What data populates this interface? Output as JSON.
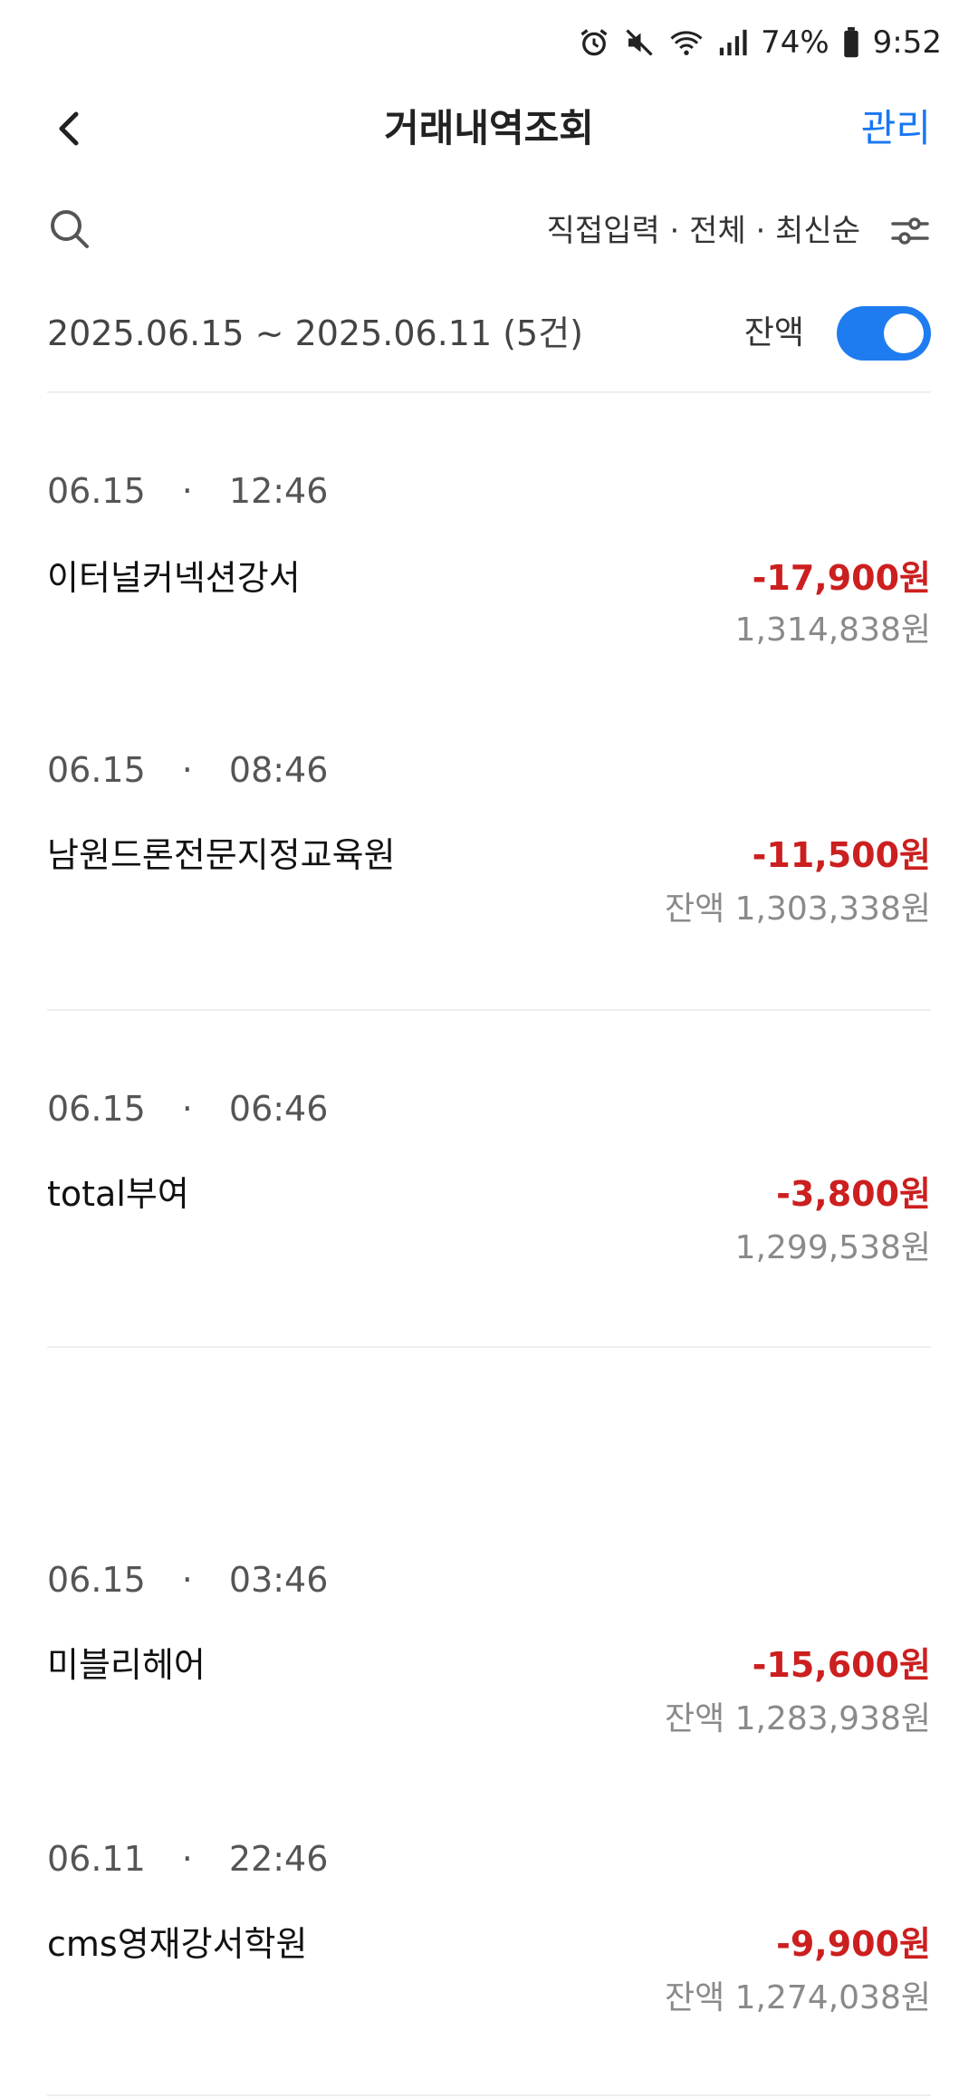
{
  "status_bar": {
    "battery": "74%",
    "time": "9:52",
    "icons": [
      "alarm-icon",
      "mute-icon",
      "wifi-icon",
      "signal-icon",
      "battery-icon"
    ]
  },
  "header": {
    "title": "거래내역조회",
    "manage_label": "관리"
  },
  "filter": {
    "summary": "직접입력 · 전체 · 최신순"
  },
  "range": {
    "text": "2025.06.15 ~ 2025.06.11 (5건)",
    "balance_label": "잔액",
    "balance_toggle_on": true
  },
  "transactions": [
    {
      "date": "06.15",
      "time": "12:46",
      "merchant": "이터널커넥션강서",
      "amount": "-17,900원",
      "balance": "1,314,838원"
    },
    {
      "date": "06.15",
      "time": "08:46",
      "merchant": "남원드론전문지정교육원",
      "amount": "-11,500원",
      "balance": "잔액 1,303,338원"
    },
    {
      "date": "06.15",
      "time": "06:46",
      "merchant": "total부여",
      "amount": "-3,800원",
      "balance": "1,299,538원"
    },
    {
      "date": "06.15",
      "time": "03:46",
      "merchant": "미블리헤어",
      "amount": "-15,600원",
      "balance": "잔액 1,283,938원"
    },
    {
      "date": "06.11",
      "time": "22:46",
      "merchant": "cms영재강서학원",
      "amount": "-9,900원",
      "balance": "잔액 1,274,038원"
    }
  ],
  "colors": {
    "accent": "#1877f2",
    "toggle": "#1e7cf0",
    "negative_amount": "#cc1f1f",
    "balance_text": "#8a8a8a"
  }
}
